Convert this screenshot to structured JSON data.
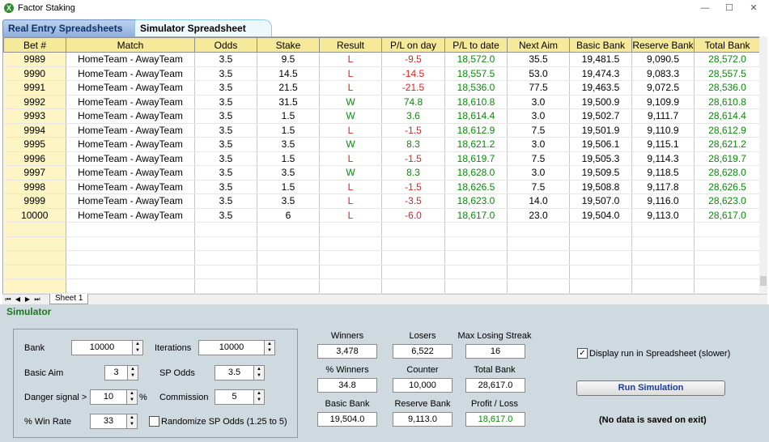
{
  "window": {
    "title": "Factor Staking",
    "minimize": "—",
    "maximize": "☐",
    "close": "✕",
    "app_icon": "excel-x-icon"
  },
  "tabs": [
    {
      "label": "Real Entry Spreadsheets"
    },
    {
      "label": "Simulator Spreadsheet"
    }
  ],
  "table": {
    "columns": [
      "Bet #",
      "Match",
      "Odds",
      "Stake",
      "Result",
      "P/L on day",
      "P/L to date",
      "Next Aim",
      "Basic Bank",
      "Reserve Bank",
      "Total Bank"
    ],
    "rows": [
      [
        "9989",
        "HomeTeam - AwayTeam",
        "3.5",
        "9.5",
        "L",
        "-9.5",
        "18,572.0",
        "35.5",
        "19,481.5",
        "9,090.5",
        "28,572.0"
      ],
      [
        "9990",
        "HomeTeam - AwayTeam",
        "3.5",
        "14.5",
        "L",
        "-14.5",
        "18,557.5",
        "53.0",
        "19,474.3",
        "9,083.3",
        "28,557.5"
      ],
      [
        "9991",
        "HomeTeam - AwayTeam",
        "3.5",
        "21.5",
        "L",
        "-21.5",
        "18,536.0",
        "77.5",
        "19,463.5",
        "9,072.5",
        "28,536.0"
      ],
      [
        "9992",
        "HomeTeam - AwayTeam",
        "3.5",
        "31.5",
        "W",
        "74.8",
        "18,610.8",
        "3.0",
        "19,500.9",
        "9,109.9",
        "28,610.8"
      ],
      [
        "9993",
        "HomeTeam - AwayTeam",
        "3.5",
        "1.5",
        "W",
        "3.6",
        "18,614.4",
        "3.0",
        "19,502.7",
        "9,111.7",
        "28,614.4"
      ],
      [
        "9994",
        "HomeTeam - AwayTeam",
        "3.5",
        "1.5",
        "L",
        "-1.5",
        "18,612.9",
        "7.5",
        "19,501.9",
        "9,110.9",
        "28,612.9"
      ],
      [
        "9995",
        "HomeTeam - AwayTeam",
        "3.5",
        "3.5",
        "W",
        "8.3",
        "18,621.2",
        "3.0",
        "19,506.1",
        "9,115.1",
        "28,621.2"
      ],
      [
        "9996",
        "HomeTeam - AwayTeam",
        "3.5",
        "1.5",
        "L",
        "-1.5",
        "18,619.7",
        "7.5",
        "19,505.3",
        "9,114.3",
        "28,619.7"
      ],
      [
        "9997",
        "HomeTeam - AwayTeam",
        "3.5",
        "3.5",
        "W",
        "8.3",
        "18,628.0",
        "3.0",
        "19,509.5",
        "9,118.5",
        "28,628.0"
      ],
      [
        "9998",
        "HomeTeam - AwayTeam",
        "3.5",
        "1.5",
        "L",
        "-1.5",
        "18,626.5",
        "7.5",
        "19,508.8",
        "9,117.8",
        "28,626.5"
      ],
      [
        "9999",
        "HomeTeam - AwayTeam",
        "3.5",
        "3.5",
        "L",
        "-3.5",
        "18,623.0",
        "14.0",
        "19,507.0",
        "9,116.0",
        "28,623.0"
      ],
      [
        "10000",
        "HomeTeam - AwayTeam",
        "3.5",
        "6",
        "L",
        "-6.0",
        "18,617.0",
        "23.0",
        "19,504.0",
        "9,113.0",
        "28,617.0"
      ]
    ],
    "empty_rows": 6
  },
  "sheet_nav": {
    "first": "⏮",
    "prev": "◀",
    "next": "▶",
    "last": "⏭",
    "sheet_name": "Sheet 1"
  },
  "simulator": {
    "title": "Simulator",
    "inputs": {
      "bank": {
        "label": "Bank",
        "value": "10000"
      },
      "iterations": {
        "label": "Iterations",
        "value": "10000"
      },
      "basic_aim": {
        "label": "Basic Aim",
        "value": "3"
      },
      "sp_odds": {
        "label": "SP Odds",
        "value": "3.5"
      },
      "danger_signal": {
        "label": "Danger signal >",
        "value": "10",
        "unit": "%"
      },
      "commission": {
        "label": "Commission",
        "value": "5"
      },
      "win_rate": {
        "label": "% Win Rate",
        "value": "33"
      },
      "randomize": {
        "label": "Randomize SP Odds (1.25 to 5)",
        "checked": false
      }
    },
    "stats": {
      "winners": {
        "label": "Winners",
        "value": "3,478"
      },
      "losers": {
        "label": "Losers",
        "value": "6,522"
      },
      "max_losing_streak": {
        "label": "Max Losing Streak",
        "value": "16"
      },
      "pct_winners": {
        "label": "% Winners",
        "value": "34.8"
      },
      "counter": {
        "label": "Counter",
        "value": "10,000"
      },
      "total_bank": {
        "label": "Total Bank",
        "value": "28,617.0"
      },
      "basic_bank": {
        "label": "Basic Bank",
        "value": "19,504.0"
      },
      "reserve_bank": {
        "label": "Reserve Bank",
        "value": "9,113.0"
      },
      "profit_loss": {
        "label": "Profit / Loss",
        "value": "18,617.0"
      }
    },
    "display_run": {
      "label": "Display run in Spreadsheet (slower)",
      "checked": true
    },
    "run_button": "Run Simulation",
    "note": "(No data is saved on exit)"
  },
  "colors": {
    "loss": "#e02020",
    "win": "#0a8a0a",
    "header_bg": "#f6e99a",
    "panel_bg": "#cfd9e0"
  }
}
